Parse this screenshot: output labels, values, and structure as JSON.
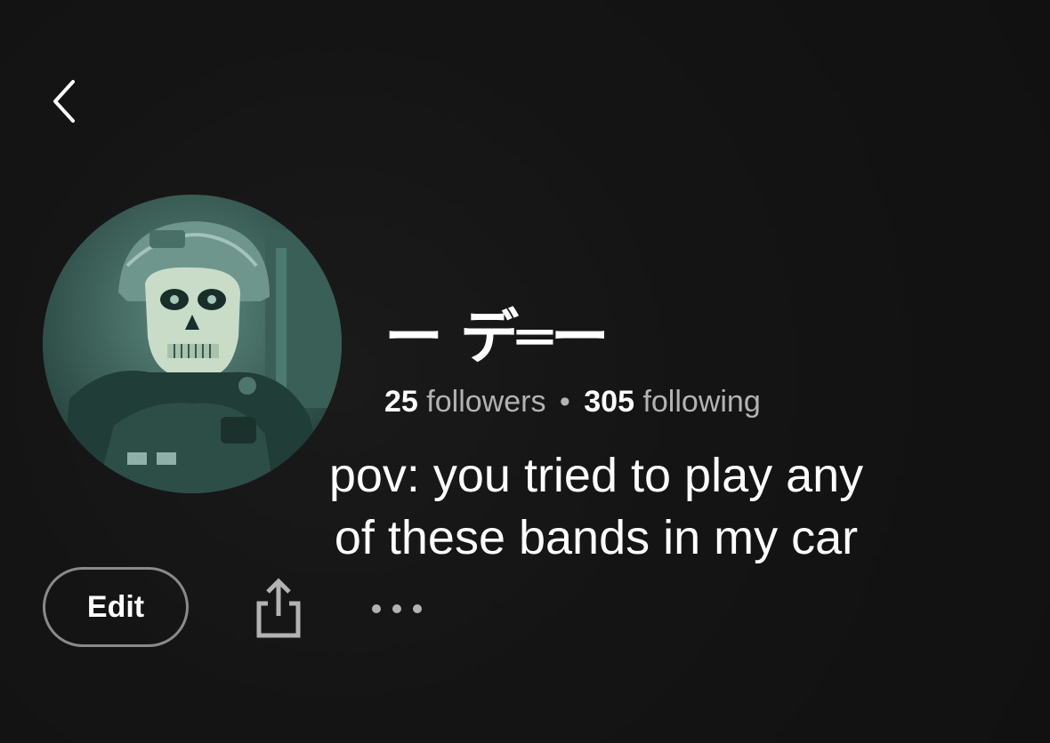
{
  "header": {
    "back_icon": "chevron-left-icon"
  },
  "profile": {
    "avatar_icon": "skull-mask-soldier-avatar",
    "name": "ー デ═ー",
    "followers_count": "25",
    "followers_label": "followers",
    "separator": "•",
    "following_count": "305",
    "following_label": "following"
  },
  "caption": {
    "line1": "pov: you tried to play any",
    "line2": "of these bands in my car"
  },
  "actions": {
    "edit_label": "Edit",
    "share_icon": "share-icon",
    "more_icon": "more-horizontal-icon"
  },
  "colors": {
    "background": "#121212",
    "text_primary": "#ffffff",
    "text_secondary": "#b3b3b3",
    "button_border": "#8a8a8a",
    "avatar_tint": "#2b4a44"
  }
}
